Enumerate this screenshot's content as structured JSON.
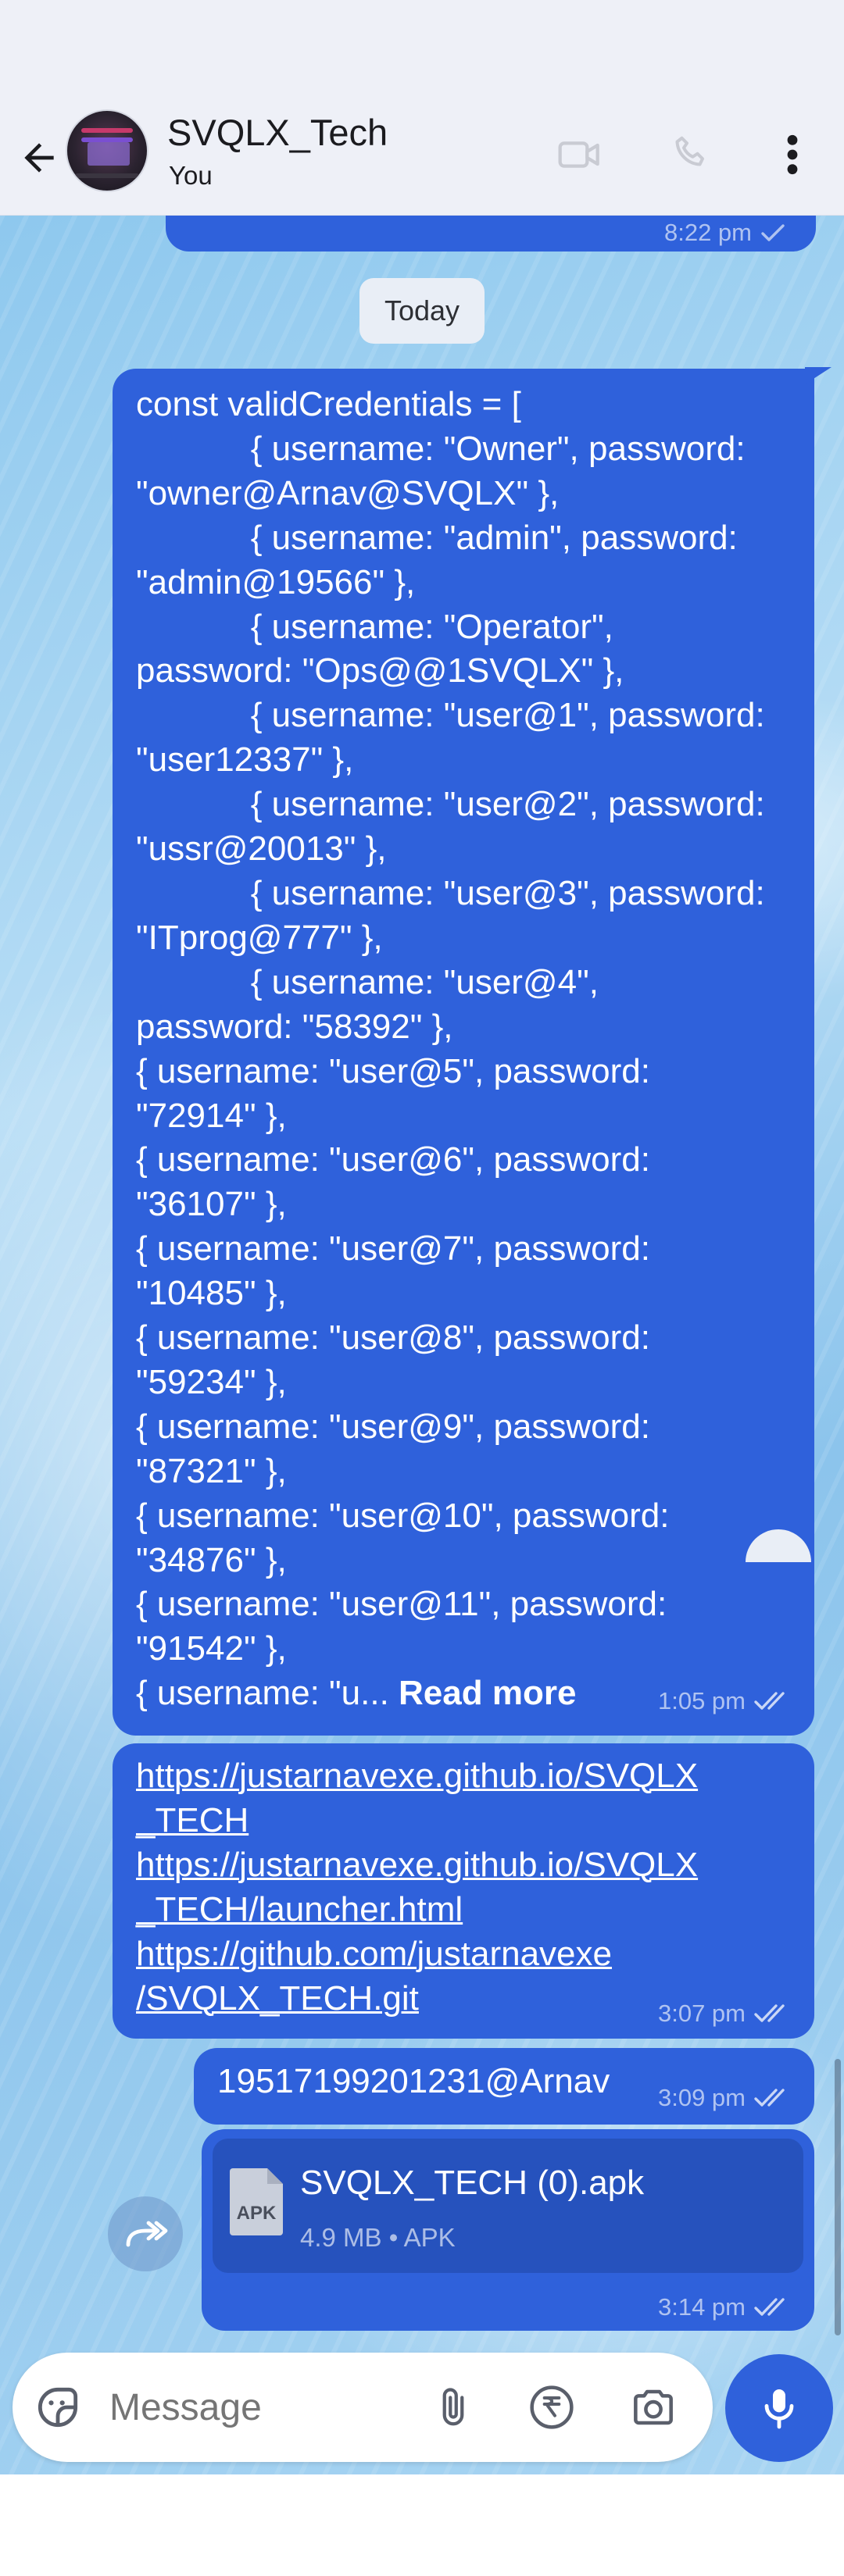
{
  "colors": {
    "accent": "#2f61db",
    "bubble": "#2f61db",
    "header_bg": "#eef0f7",
    "file_card": "#2652bd"
  },
  "header": {
    "title": "SVQLX_Tech",
    "subtitle": "You",
    "icons": [
      "back-arrow-icon",
      "video-call-icon",
      "voice-call-icon",
      "more-options-icon"
    ]
  },
  "messages": {
    "prev_time": "8:22 pm",
    "date_chip": "Today",
    "code_message": {
      "lines": [
        "const validCredentials = [",
        "            { username: \"Owner\", password:",
        "\"owner@Arnav@SVQLX\" },",
        "            { username: \"admin\", password:",
        "\"admin@19566\" },",
        "            { username: \"Operator\",",
        "password: \"Ops@@1SVQLX\" },",
        "            { username: \"user@1\", password:",
        "\"user12337\" },",
        "            { username: \"user@2\", password:",
        "\"ussr@20013\" },",
        "            { username: \"user@3\", password:",
        "\"ITprog@777\" },",
        "            { username: \"user@4\",",
        "password: \"58392\" },",
        "{ username: \"user@5\", password:",
        "\"72914\" },",
        "{ username: \"user@6\", password:",
        "\"36107\" },",
        "{ username: \"user@7\", password:",
        "\"10485\" },",
        "{ username: \"user@8\", password:",
        "\"59234\" },",
        "{ username: \"user@9\", password:",
        "\"87321\" },",
        "{ username: \"user@10\", password:",
        "\"34876\" },",
        "{ username: \"user@11\", password:",
        "\"91542\" },"
      ],
      "truncated_line": "{ username: \"u... ",
      "read_more": "Read more",
      "time": "1:05 pm"
    },
    "links_message": {
      "links": [
        "https://justarnavexe.github.io/SVQLX",
        "_TECH",
        "https://justarnavexe.github.io/SVQLX",
        "_TECH/launcher.html",
        "https://github.com/justarnavexe",
        "/SVQLX_TECH.git"
      ],
      "time": "3:07 pm"
    },
    "password_message": {
      "text": "19517199201231@Arnav",
      "time": "3:09 pm"
    },
    "file_message": {
      "file_name": "SVQLX_TECH (0).apk",
      "file_meta": "4.9 MB • APK",
      "file_type_badge": "APK",
      "time": "3:14 pm"
    }
  },
  "composer": {
    "placeholder": "Message",
    "icons": [
      "sticker-icon",
      "attach-icon",
      "rupee-payment-icon",
      "camera-icon",
      "mic-icon"
    ]
  }
}
